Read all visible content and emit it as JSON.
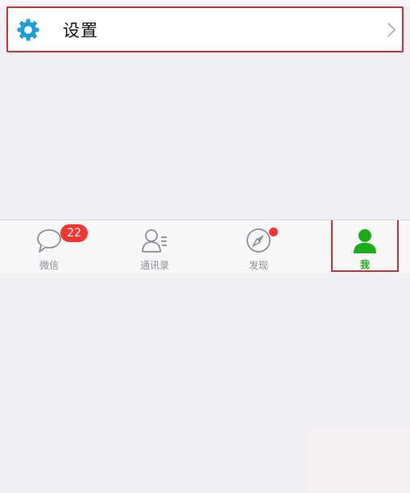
{
  "settings": {
    "label": "设置",
    "icon": "gear-icon",
    "accent_color": "#1aa0d8"
  },
  "tabbar": {
    "tabs": [
      {
        "label": "微信",
        "icon": "chat-bubble-icon",
        "badge": "22"
      },
      {
        "label": "通讯录",
        "icon": "contacts-icon"
      },
      {
        "label": "发现",
        "icon": "compass-icon",
        "dot": true
      },
      {
        "label": "我",
        "icon": "person-icon",
        "selected": true
      }
    ],
    "active_color": "#1aad19",
    "badge_color": "#f43530"
  }
}
